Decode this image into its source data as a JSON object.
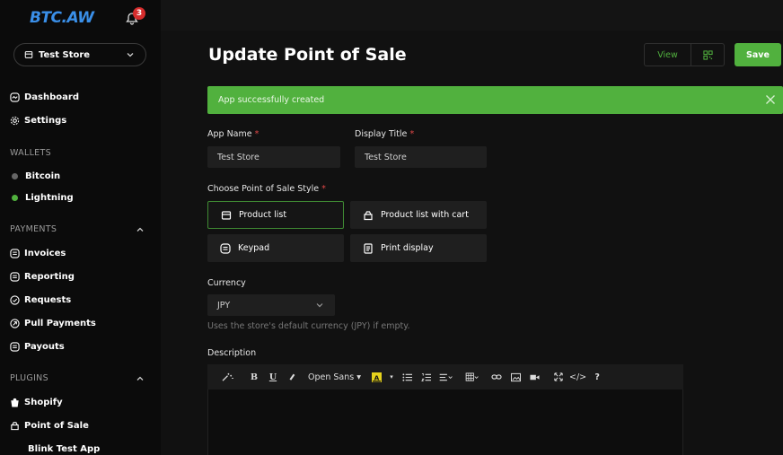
{
  "brand": "BTC.AW",
  "notification_count": "3",
  "store": {
    "label": "Test Store"
  },
  "nav": {
    "dashboard": "Dashboard",
    "settings": "Settings",
    "wallets_section": "WALLETS",
    "bitcoin": "Bitcoin",
    "lightning": "Lightning",
    "payments_section": "PAYMENTS",
    "invoices": "Invoices",
    "reporting": "Reporting",
    "requests": "Requests",
    "pull_payments": "Pull Payments",
    "payouts": "Payouts",
    "plugins_section": "PLUGINS",
    "shopify": "Shopify",
    "point_of_sale": "Point of Sale",
    "blink_test_app": "Blink Test App"
  },
  "page": {
    "title": "Update Point of Sale",
    "view_label": "View",
    "save_label": "Save"
  },
  "alert": {
    "message": "App successfully created"
  },
  "form": {
    "app_name_label": "App Name",
    "app_name_value": "Test Store",
    "display_title_label": "Display Title",
    "display_title_value": "Test Store",
    "required_marker": "*",
    "style_label": "Choose Point of Sale Style",
    "styles": [
      "Product list",
      "Product list with cart",
      "Keypad",
      "Print display"
    ],
    "currency_label": "Currency",
    "currency_value": "JPY",
    "currency_hint": "Uses the store's default currency (JPY) if empty.",
    "description_label": "Description",
    "font_family": "Open Sans"
  },
  "colors": {
    "accent": "#51b13e",
    "brand": "#3a8fe8",
    "notification": "#d62d2d",
    "lightning_dot": "#51b13e",
    "bitcoin_dot": "#666666"
  }
}
